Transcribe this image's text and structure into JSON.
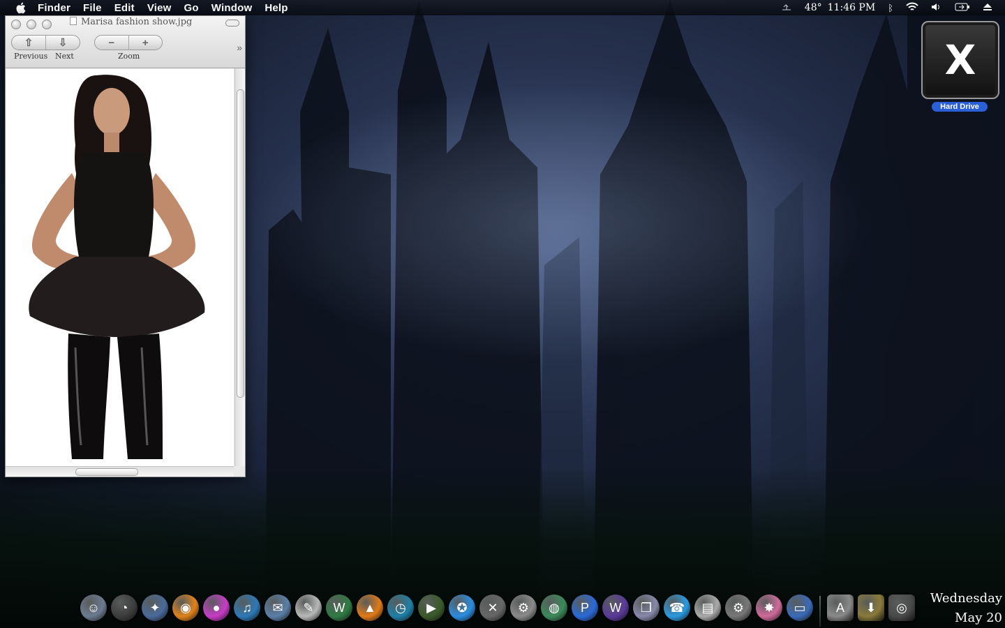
{
  "menubar": {
    "app_name": "Finder",
    "items": [
      "File",
      "Edit",
      "View",
      "Go",
      "Window",
      "Help"
    ],
    "status": {
      "temperature": "48°",
      "time": "11:46 PM",
      "icons": [
        "weather-icon",
        "bluetooth-icon",
        "wifi-icon",
        "volume-icon",
        "battery-icon",
        "eject-icon"
      ]
    }
  },
  "preview_window": {
    "title": "Marisa fashion show.jpg",
    "toolbar": {
      "previous_label": "Previous",
      "next_label": "Next",
      "zoom_label": "Zoom"
    }
  },
  "desktop": {
    "hard_drive_label": "Hard Drive",
    "hard_drive_glyph": "X"
  },
  "dock": {
    "items": [
      {
        "name": "finder",
        "glyph": "☺",
        "color": "#6b7a90"
      },
      {
        "name": "dashboard",
        "glyph": "◔",
        "color": "#3c3c3c"
      },
      {
        "name": "safari",
        "glyph": "✦",
        "color": "#4a6a9a"
      },
      {
        "name": "firefox",
        "glyph": "◉",
        "color": "#e0821c"
      },
      {
        "name": "color-picker",
        "glyph": "●",
        "color": "#c83cc8"
      },
      {
        "name": "itunes",
        "glyph": "♫",
        "color": "#2d79b7"
      },
      {
        "name": "mail",
        "glyph": "✉",
        "color": "#5a7fa8"
      },
      {
        "name": "textedit",
        "glyph": "✎",
        "color": "#b8b8b8"
      },
      {
        "name": "dreamweaver",
        "glyph": "W",
        "color": "#2f7a43"
      },
      {
        "name": "vlc",
        "glyph": "▲",
        "color": "#e07a18"
      },
      {
        "name": "ical",
        "glyph": "◷",
        "color": "#1e7fa8"
      },
      {
        "name": "quicktime",
        "glyph": "▶",
        "color": "#3a5a2a"
      },
      {
        "name": "app-store",
        "glyph": "✪",
        "color": "#2a8de0"
      },
      {
        "name": "xcode",
        "glyph": "✕",
        "color": "#666"
      },
      {
        "name": "automator",
        "glyph": "⚙",
        "color": "#8a8a8a"
      },
      {
        "name": "globe",
        "glyph": "◍",
        "color": "#3a8a5a"
      },
      {
        "name": "photoshop",
        "glyph": "P",
        "color": "#2a6ad8"
      },
      {
        "name": "warcraft",
        "glyph": "W",
        "color": "#5a3a9a"
      },
      {
        "name": "trash-app",
        "glyph": "❐",
        "color": "#88a"
      },
      {
        "name": "ichat",
        "glyph": "☎",
        "color": "#2a9ae0"
      },
      {
        "name": "printer",
        "glyph": "▤",
        "color": "#aaa"
      },
      {
        "name": "system-preferences",
        "glyph": "⚙",
        "color": "#777"
      },
      {
        "name": "lollipop",
        "glyph": "✸",
        "color": "#d06a9a"
      },
      {
        "name": "screen-sharing",
        "glyph": "▭",
        "color": "#3a6ab8"
      }
    ],
    "stack_items": [
      {
        "name": "applications-folder",
        "glyph": "A",
        "color": "#8a8a8a"
      },
      {
        "name": "downloads-folder",
        "glyph": "⬇",
        "color": "#8a7a3a"
      },
      {
        "name": "trash",
        "glyph": "◎",
        "color": "#4a4a4a"
      }
    ]
  },
  "date_widget": {
    "weekday": "Wednesday",
    "date": "May 20"
  }
}
